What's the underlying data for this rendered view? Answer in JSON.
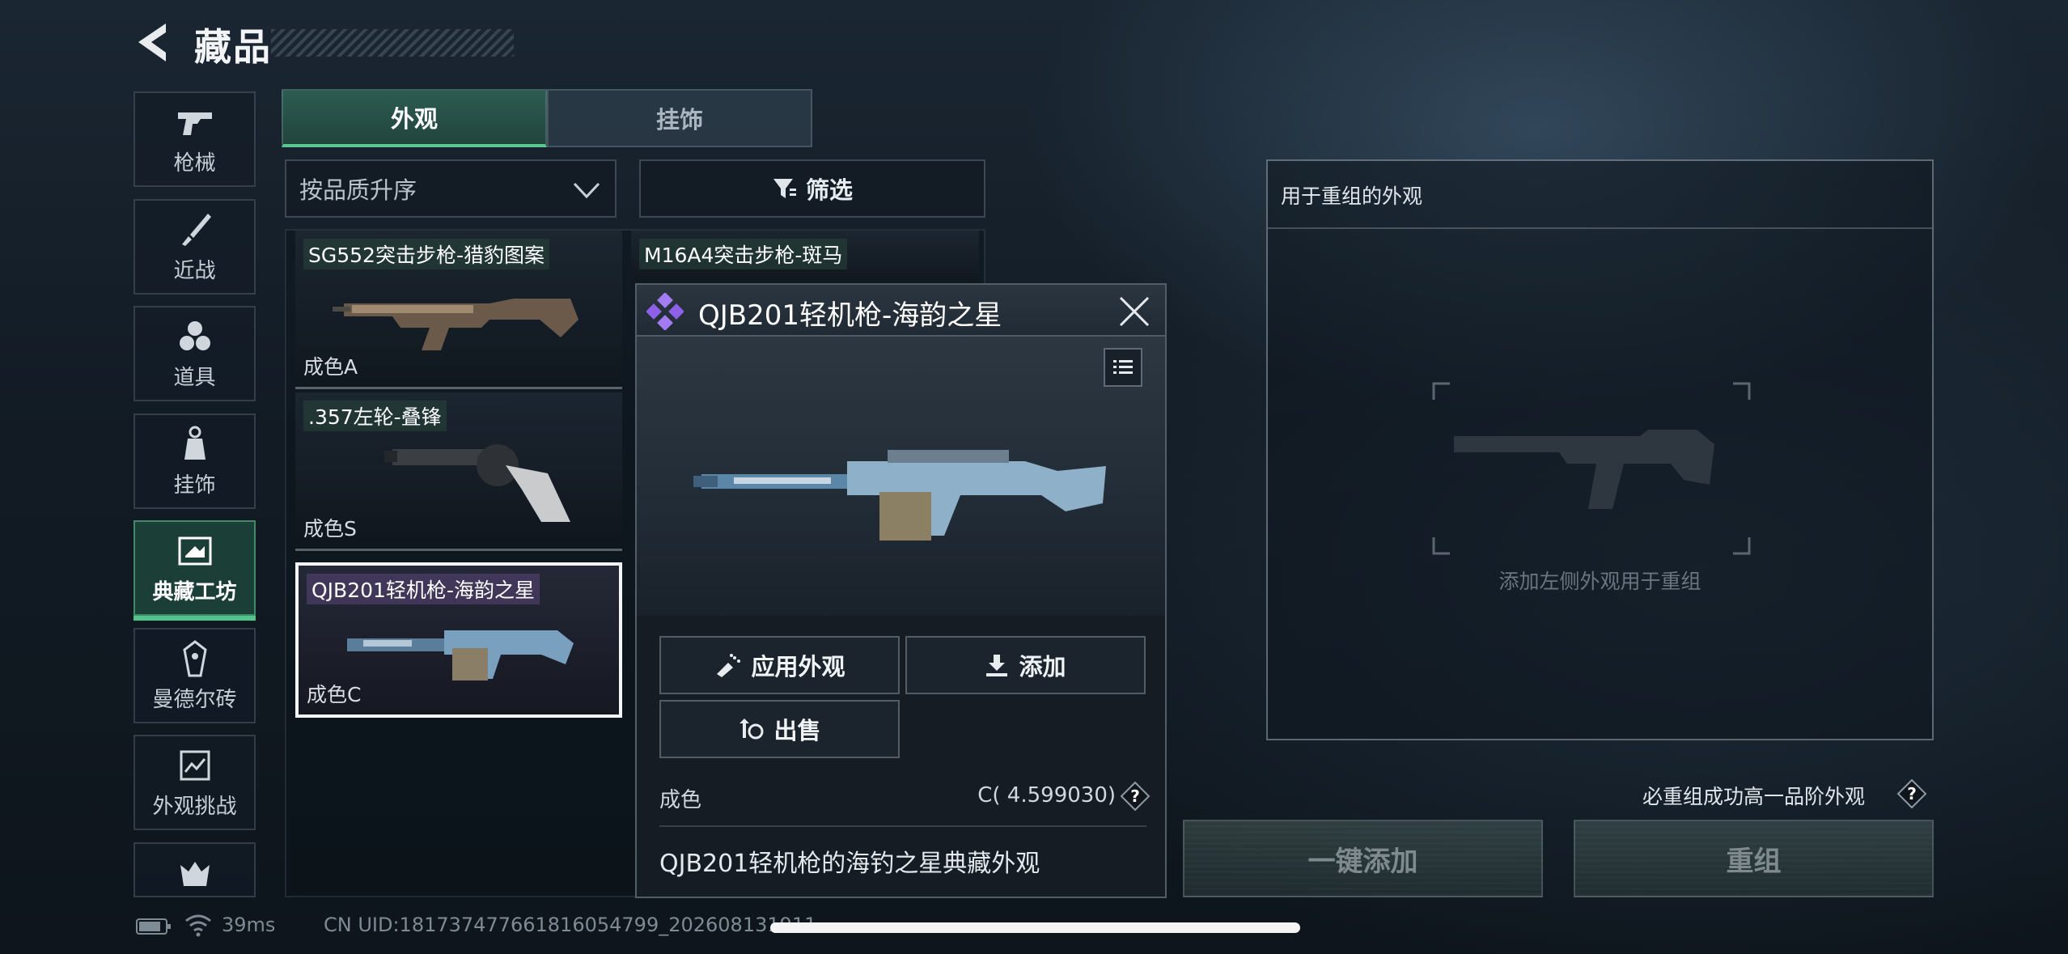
{
  "header": {
    "title": "藏品",
    "back_icon": "back-arrow-icon"
  },
  "sidebar": {
    "items": [
      {
        "label": "枪械",
        "icon": "gun-icon",
        "active": false
      },
      {
        "label": "近战",
        "icon": "knife-icon",
        "active": false
      },
      {
        "label": "道具",
        "icon": "grenade-icon",
        "active": false
      },
      {
        "label": "挂饰",
        "icon": "charm-icon",
        "active": false
      },
      {
        "label": "典藏工坊",
        "icon": "workshop-icon",
        "active": true
      },
      {
        "label": "曼德尔砖",
        "icon": "brick-icon",
        "active": false
      },
      {
        "label": "外观挑战",
        "icon": "challenge-icon",
        "active": false
      },
      {
        "label": "",
        "icon": "crown-icon",
        "active": false
      }
    ]
  },
  "tabs": [
    {
      "label": "外观",
      "active": true
    },
    {
      "label": "挂饰",
      "active": false
    }
  ],
  "sort": {
    "selected": "按品质升序"
  },
  "filter": {
    "label": "筛选"
  },
  "items": [
    {
      "name": "SG552突击步枪-猎豹图案",
      "grade": "成色A",
      "selected": false
    },
    {
      "name": "M16A4突击步枪-斑马",
      "grade": "",
      "selected": false
    },
    {
      "name": ".357左轮-叠锋",
      "grade": "成色S",
      "selected": false
    },
    {
      "name": "QJB201轻机枪-海韵之星",
      "grade": "成色C",
      "selected": true
    }
  ],
  "detail": {
    "title": "QJB201轻机枪-海韵之星",
    "rarity_color": "#9b6cf0",
    "apply_label": "应用外观",
    "add_label": "添加",
    "sell_label": "出售",
    "condition_label": "成色",
    "condition_value": "C( 4.599030)",
    "description": "QJB201轻机枪的海钓之星典藏外观"
  },
  "recombine": {
    "title": "用于重组的外观",
    "hint": "添加左侧外观用于重组",
    "guarantee_text": "必重组成功高一品阶外观",
    "quick_add_label": "一键添加",
    "recombine_label": "重组"
  },
  "status": {
    "ping": "39ms",
    "uid": "CN UID:1817374776618160547​99_202608131911"
  },
  "colors": {
    "accent": "#4fc58a",
    "rarity_purple": "#9b6cf0"
  }
}
